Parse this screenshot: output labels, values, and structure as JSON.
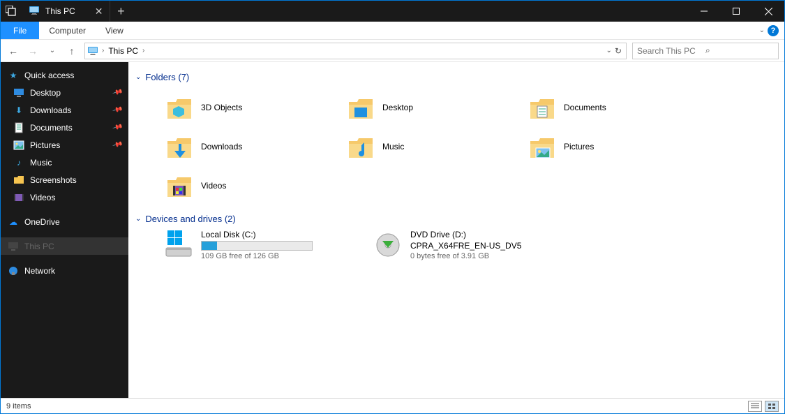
{
  "titlebar": {
    "title": "This PC"
  },
  "menu": {
    "file": "File",
    "computer": "Computer",
    "view": "View"
  },
  "addressbar": {
    "location": "This PC"
  },
  "search": {
    "placeholder": "Search This PC"
  },
  "sidebar": {
    "quick_access": "Quick access",
    "desktop": "Desktop",
    "downloads": "Downloads",
    "documents": "Documents",
    "pictures": "Pictures",
    "music": "Music",
    "screenshots": "Screenshots",
    "videos": "Videos",
    "onedrive": "OneDrive",
    "this_pc": "This PC",
    "network": "Network"
  },
  "sections": {
    "folders_label": "Folders (7)",
    "drives_label": "Devices and drives (2)"
  },
  "folders": {
    "obj3d": "3D Objects",
    "desktop": "Desktop",
    "documents": "Documents",
    "downloads": "Downloads",
    "music": "Music",
    "pictures": "Pictures",
    "videos": "Videos"
  },
  "drives": {
    "c": {
      "name": "Local Disk (C:)",
      "free": "109 GB free of 126 GB",
      "used_pct": 14
    },
    "d": {
      "name": "DVD Drive (D:)",
      "label": "CPRA_X64FRE_EN-US_DV5",
      "free": "0 bytes free of 3.91 GB"
    }
  },
  "statusbar": {
    "items": "9 items"
  }
}
